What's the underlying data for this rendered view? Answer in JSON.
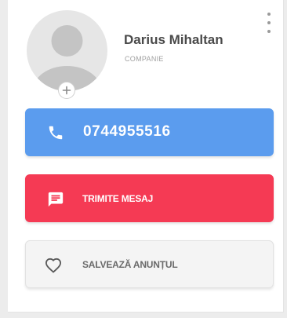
{
  "seller": {
    "name": "Darius Mihaltan",
    "role": "COMPANIE"
  },
  "actions": {
    "phone_number": "0744955516",
    "message_label": "TRIMITE MESAJ",
    "save_label": "SALVEAZĂ ANUNȚUL"
  },
  "icons": {
    "avatar": "person-silhouette",
    "avatar_add": "plus-icon",
    "menu": "kebab-icon",
    "phone": "phone-icon",
    "message": "chat-icon",
    "save": "heart-outline-icon"
  },
  "colors": {
    "phone_button": "#5b9cee",
    "message_button": "#f53a54",
    "save_button": "#f4f4f4"
  }
}
